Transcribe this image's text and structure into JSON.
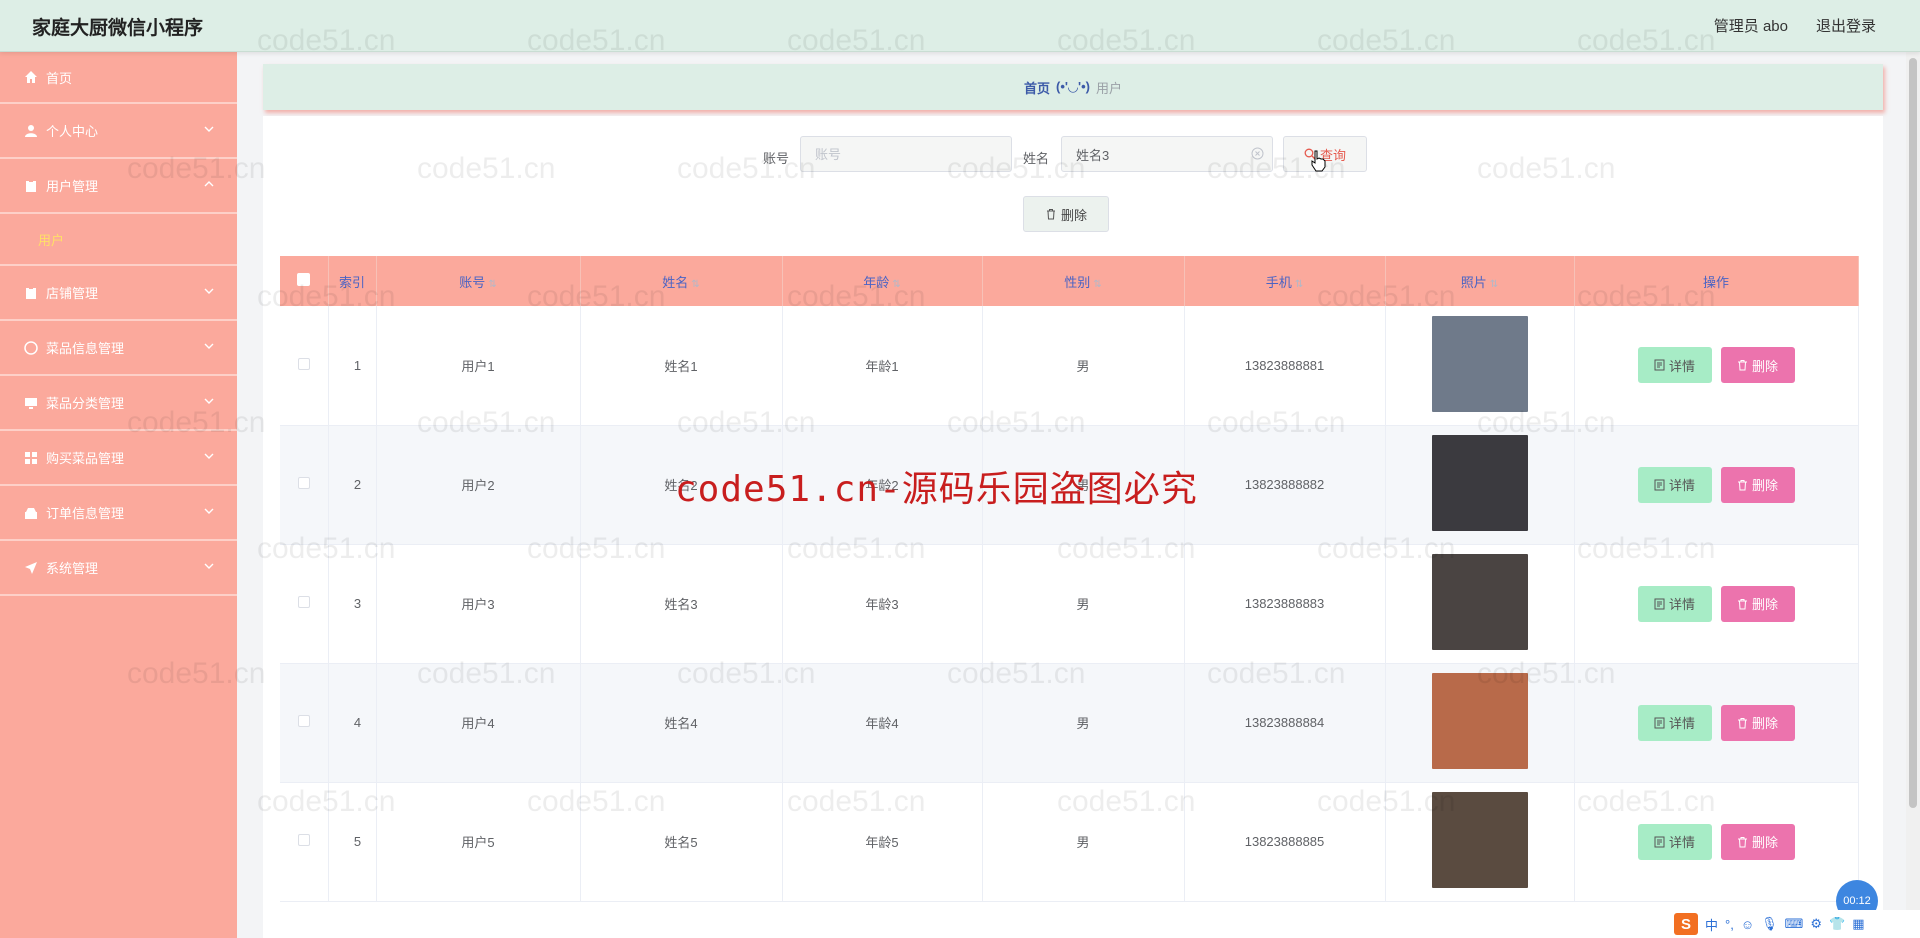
{
  "app": {
    "title": "家庭大厨微信小程序",
    "role_user": "管理员 abo",
    "logout": "退出登录"
  },
  "sidebar": {
    "items": [
      {
        "label": "首页",
        "icon": "home-icon"
      },
      {
        "label": "个人中心",
        "icon": "user-icon"
      },
      {
        "label": "用户管理",
        "icon": "clipboard-icon"
      },
      {
        "label": "店铺管理",
        "icon": "clipboard-icon"
      },
      {
        "label": "菜品信息管理",
        "icon": "compass-icon"
      },
      {
        "label": "菜品分类管理",
        "icon": "monitor-icon"
      },
      {
        "label": "购买菜品管理",
        "icon": "grid-icon"
      },
      {
        "label": "订单信息管理",
        "icon": "shop-icon"
      },
      {
        "label": "系统管理",
        "icon": "send-icon"
      }
    ],
    "submenu_user": "用户"
  },
  "breadcrumb": {
    "home": "首页",
    "face": "(•'◡'•)",
    "current": "用户"
  },
  "search": {
    "account_label": "账号",
    "account_placeholder": "账号",
    "account_value": "",
    "name_label": "姓名",
    "name_placeholder": "姓名",
    "name_value": "姓名3",
    "search_button": "查询",
    "delete_button": "删除"
  },
  "table": {
    "headers": {
      "index": "索引",
      "account": "账号",
      "name": "姓名",
      "age": "年龄",
      "gender": "性别",
      "phone": "手机",
      "photo": "照片",
      "actions": "操作"
    },
    "rows": [
      {
        "index": "1",
        "account": "用户1",
        "name": "姓名1",
        "age": "年龄1",
        "gender": "男",
        "phone": "13823888881",
        "photo_color": "#6f7a8a"
      },
      {
        "index": "2",
        "account": "用户2",
        "name": "姓名2",
        "age": "年龄2",
        "gender": "男",
        "phone": "13823888882",
        "photo_color": "#3b3a3f"
      },
      {
        "index": "3",
        "account": "用户3",
        "name": "姓名3",
        "age": "年龄3",
        "gender": "男",
        "phone": "13823888883",
        "photo_color": "#4a4442"
      },
      {
        "index": "4",
        "account": "用户4",
        "name": "姓名4",
        "age": "年龄4",
        "gender": "男",
        "phone": "13823888884",
        "photo_color": "#b86a4a"
      },
      {
        "index": "5",
        "account": "用户5",
        "name": "姓名5",
        "age": "年龄5",
        "gender": "男",
        "phone": "13823888885",
        "photo_color": "#5a4b40"
      }
    ],
    "detail_label": "详情",
    "delete_label": "删除"
  },
  "watermark": {
    "main": "code51.cn-源码乐园盗图必究",
    "tile": "code51.cn"
  },
  "tray": {
    "logo": "S",
    "lang": "中",
    "timer": "00:12"
  }
}
